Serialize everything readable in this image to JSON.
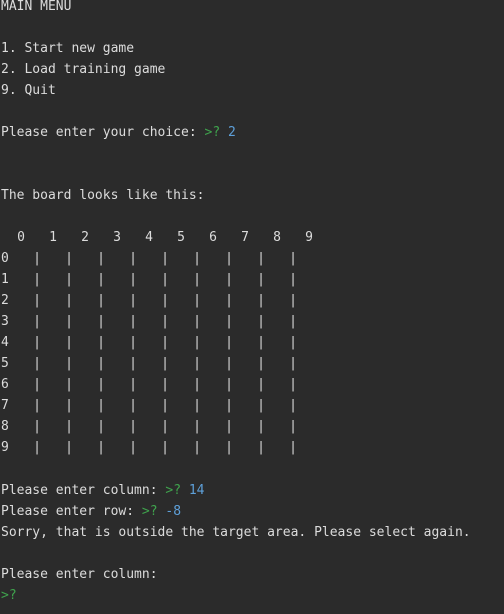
{
  "menu": {
    "title": "MAIN MENU",
    "items": [
      "1. Start new game",
      "2. Load training game",
      "9. Quit"
    ]
  },
  "choice": {
    "prompt_text": "Please enter your choice: ",
    "prompt": ">?",
    "value": "2"
  },
  "board_intro": "The board looks like this:",
  "board": {
    "columns": [
      "0",
      "1",
      "2",
      "3",
      "4",
      "5",
      "6",
      "7",
      "8",
      "9"
    ],
    "rows": [
      "0",
      "1",
      "2",
      "3",
      "4",
      "5",
      "6",
      "7",
      "8",
      "9"
    ],
    "cell_separator": "|"
  },
  "col_entry": {
    "prompt_text": "Please enter column: ",
    "prompt": ">?",
    "value": "14"
  },
  "row_entry": {
    "prompt_text": "Please enter row: ",
    "prompt": ">?",
    "value": "-8"
  },
  "error_message": "Sorry, that is outside the target area. Please select again.",
  "col_entry2": {
    "prompt_text": "Please enter column:"
  },
  "cursor_prompt": ">?",
  "colors": {
    "background": "#2b2b2b",
    "text": "#dcdcdc",
    "prompt": "#3fa34d",
    "input": "#5ea0d9"
  }
}
